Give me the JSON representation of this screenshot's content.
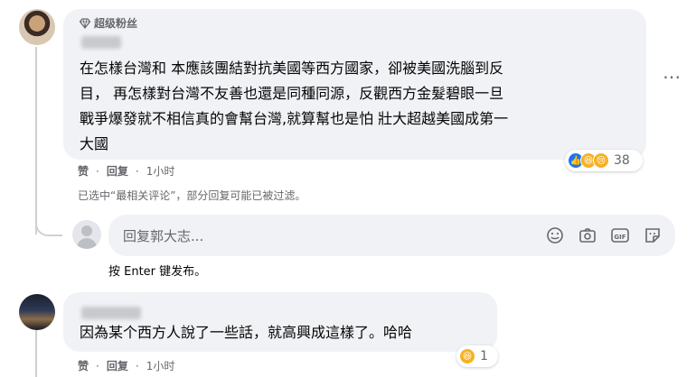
{
  "comments": [
    {
      "badge": "超级粉丝",
      "text_lines": [
        "在怎樣台灣和         本應該團結對抗美國等西方國家，卻被美國洗腦到反",
        "目，         再怎樣對台灣不友善也還是同種同源，反觀西方金髮碧眼一旦",
        "戰爭爆發就不相信真的會幫台灣,就算幫也是怕         壯大超越美國成第一",
        "大國"
      ],
      "actions": {
        "like": "赞",
        "reply": "回复",
        "time": "1小时"
      },
      "reaction_count": "38"
    },
    {
      "text_lines": [
        "因為某个西方人說了一些話，就高興成這樣了。哈哈"
      ],
      "actions": {
        "like": "赞",
        "reply": "回复",
        "time": "1小时"
      },
      "reaction_count": "1"
    }
  ],
  "filter_note": "已选中“最相关评论”，部分回复可能已被过滤。",
  "reply_box": {
    "placeholder": "回复郭大志..."
  },
  "enter_hint": "按 Enter 键发布。",
  "icons": {
    "badge": "diamond-icon",
    "reply_tools": [
      "emoji-icon",
      "camera-icon",
      "gif-icon",
      "sticker-icon"
    ],
    "more": "more-options-icon"
  },
  "colors": {
    "bubble": "#f0f2f5",
    "secondary_text": "#65676b",
    "like": "#1877f2"
  }
}
